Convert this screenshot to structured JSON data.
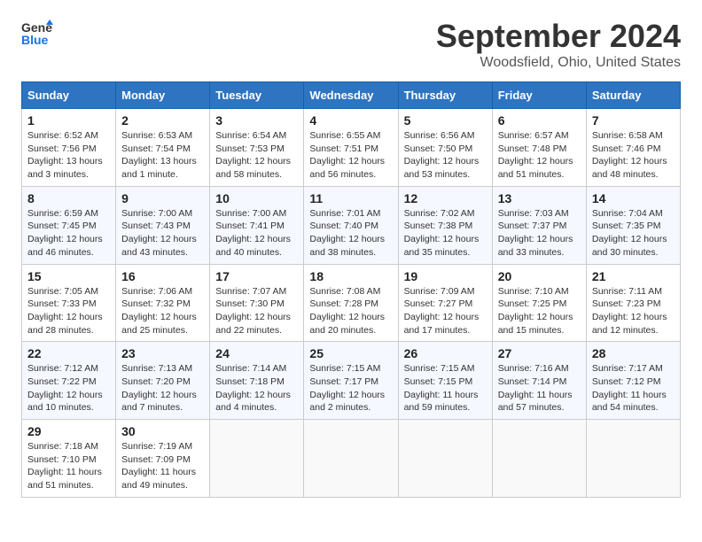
{
  "header": {
    "logo_line1": "General",
    "logo_line2": "Blue",
    "month_year": "September 2024",
    "location": "Woodsfield, Ohio, United States"
  },
  "columns": [
    "Sunday",
    "Monday",
    "Tuesday",
    "Wednesday",
    "Thursday",
    "Friday",
    "Saturday"
  ],
  "weeks": [
    [
      {
        "day": "1",
        "info": "Sunrise: 6:52 AM\nSunset: 7:56 PM\nDaylight: 13 hours\nand 3 minutes."
      },
      {
        "day": "2",
        "info": "Sunrise: 6:53 AM\nSunset: 7:54 PM\nDaylight: 13 hours\nand 1 minute."
      },
      {
        "day": "3",
        "info": "Sunrise: 6:54 AM\nSunset: 7:53 PM\nDaylight: 12 hours\nand 58 minutes."
      },
      {
        "day": "4",
        "info": "Sunrise: 6:55 AM\nSunset: 7:51 PM\nDaylight: 12 hours\nand 56 minutes."
      },
      {
        "day": "5",
        "info": "Sunrise: 6:56 AM\nSunset: 7:50 PM\nDaylight: 12 hours\nand 53 minutes."
      },
      {
        "day": "6",
        "info": "Sunrise: 6:57 AM\nSunset: 7:48 PM\nDaylight: 12 hours\nand 51 minutes."
      },
      {
        "day": "7",
        "info": "Sunrise: 6:58 AM\nSunset: 7:46 PM\nDaylight: 12 hours\nand 48 minutes."
      }
    ],
    [
      {
        "day": "8",
        "info": "Sunrise: 6:59 AM\nSunset: 7:45 PM\nDaylight: 12 hours\nand 46 minutes."
      },
      {
        "day": "9",
        "info": "Sunrise: 7:00 AM\nSunset: 7:43 PM\nDaylight: 12 hours\nand 43 minutes."
      },
      {
        "day": "10",
        "info": "Sunrise: 7:00 AM\nSunset: 7:41 PM\nDaylight: 12 hours\nand 40 minutes."
      },
      {
        "day": "11",
        "info": "Sunrise: 7:01 AM\nSunset: 7:40 PM\nDaylight: 12 hours\nand 38 minutes."
      },
      {
        "day": "12",
        "info": "Sunrise: 7:02 AM\nSunset: 7:38 PM\nDaylight: 12 hours\nand 35 minutes."
      },
      {
        "day": "13",
        "info": "Sunrise: 7:03 AM\nSunset: 7:37 PM\nDaylight: 12 hours\nand 33 minutes."
      },
      {
        "day": "14",
        "info": "Sunrise: 7:04 AM\nSunset: 7:35 PM\nDaylight: 12 hours\nand 30 minutes."
      }
    ],
    [
      {
        "day": "15",
        "info": "Sunrise: 7:05 AM\nSunset: 7:33 PM\nDaylight: 12 hours\nand 28 minutes."
      },
      {
        "day": "16",
        "info": "Sunrise: 7:06 AM\nSunset: 7:32 PM\nDaylight: 12 hours\nand 25 minutes."
      },
      {
        "day": "17",
        "info": "Sunrise: 7:07 AM\nSunset: 7:30 PM\nDaylight: 12 hours\nand 22 minutes."
      },
      {
        "day": "18",
        "info": "Sunrise: 7:08 AM\nSunset: 7:28 PM\nDaylight: 12 hours\nand 20 minutes."
      },
      {
        "day": "19",
        "info": "Sunrise: 7:09 AM\nSunset: 7:27 PM\nDaylight: 12 hours\nand 17 minutes."
      },
      {
        "day": "20",
        "info": "Sunrise: 7:10 AM\nSunset: 7:25 PM\nDaylight: 12 hours\nand 15 minutes."
      },
      {
        "day": "21",
        "info": "Sunrise: 7:11 AM\nSunset: 7:23 PM\nDaylight: 12 hours\nand 12 minutes."
      }
    ],
    [
      {
        "day": "22",
        "info": "Sunrise: 7:12 AM\nSunset: 7:22 PM\nDaylight: 12 hours\nand 10 minutes."
      },
      {
        "day": "23",
        "info": "Sunrise: 7:13 AM\nSunset: 7:20 PM\nDaylight: 12 hours\nand 7 minutes."
      },
      {
        "day": "24",
        "info": "Sunrise: 7:14 AM\nSunset: 7:18 PM\nDaylight: 12 hours\nand 4 minutes."
      },
      {
        "day": "25",
        "info": "Sunrise: 7:15 AM\nSunset: 7:17 PM\nDaylight: 12 hours\nand 2 minutes."
      },
      {
        "day": "26",
        "info": "Sunrise: 7:15 AM\nSunset: 7:15 PM\nDaylight: 11 hours\nand 59 minutes."
      },
      {
        "day": "27",
        "info": "Sunrise: 7:16 AM\nSunset: 7:14 PM\nDaylight: 11 hours\nand 57 minutes."
      },
      {
        "day": "28",
        "info": "Sunrise: 7:17 AM\nSunset: 7:12 PM\nDaylight: 11 hours\nand 54 minutes."
      }
    ],
    [
      {
        "day": "29",
        "info": "Sunrise: 7:18 AM\nSunset: 7:10 PM\nDaylight: 11 hours\nand 51 minutes."
      },
      {
        "day": "30",
        "info": "Sunrise: 7:19 AM\nSunset: 7:09 PM\nDaylight: 11 hours\nand 49 minutes."
      },
      {
        "day": "",
        "info": ""
      },
      {
        "day": "",
        "info": ""
      },
      {
        "day": "",
        "info": ""
      },
      {
        "day": "",
        "info": ""
      },
      {
        "day": "",
        "info": ""
      }
    ]
  ]
}
